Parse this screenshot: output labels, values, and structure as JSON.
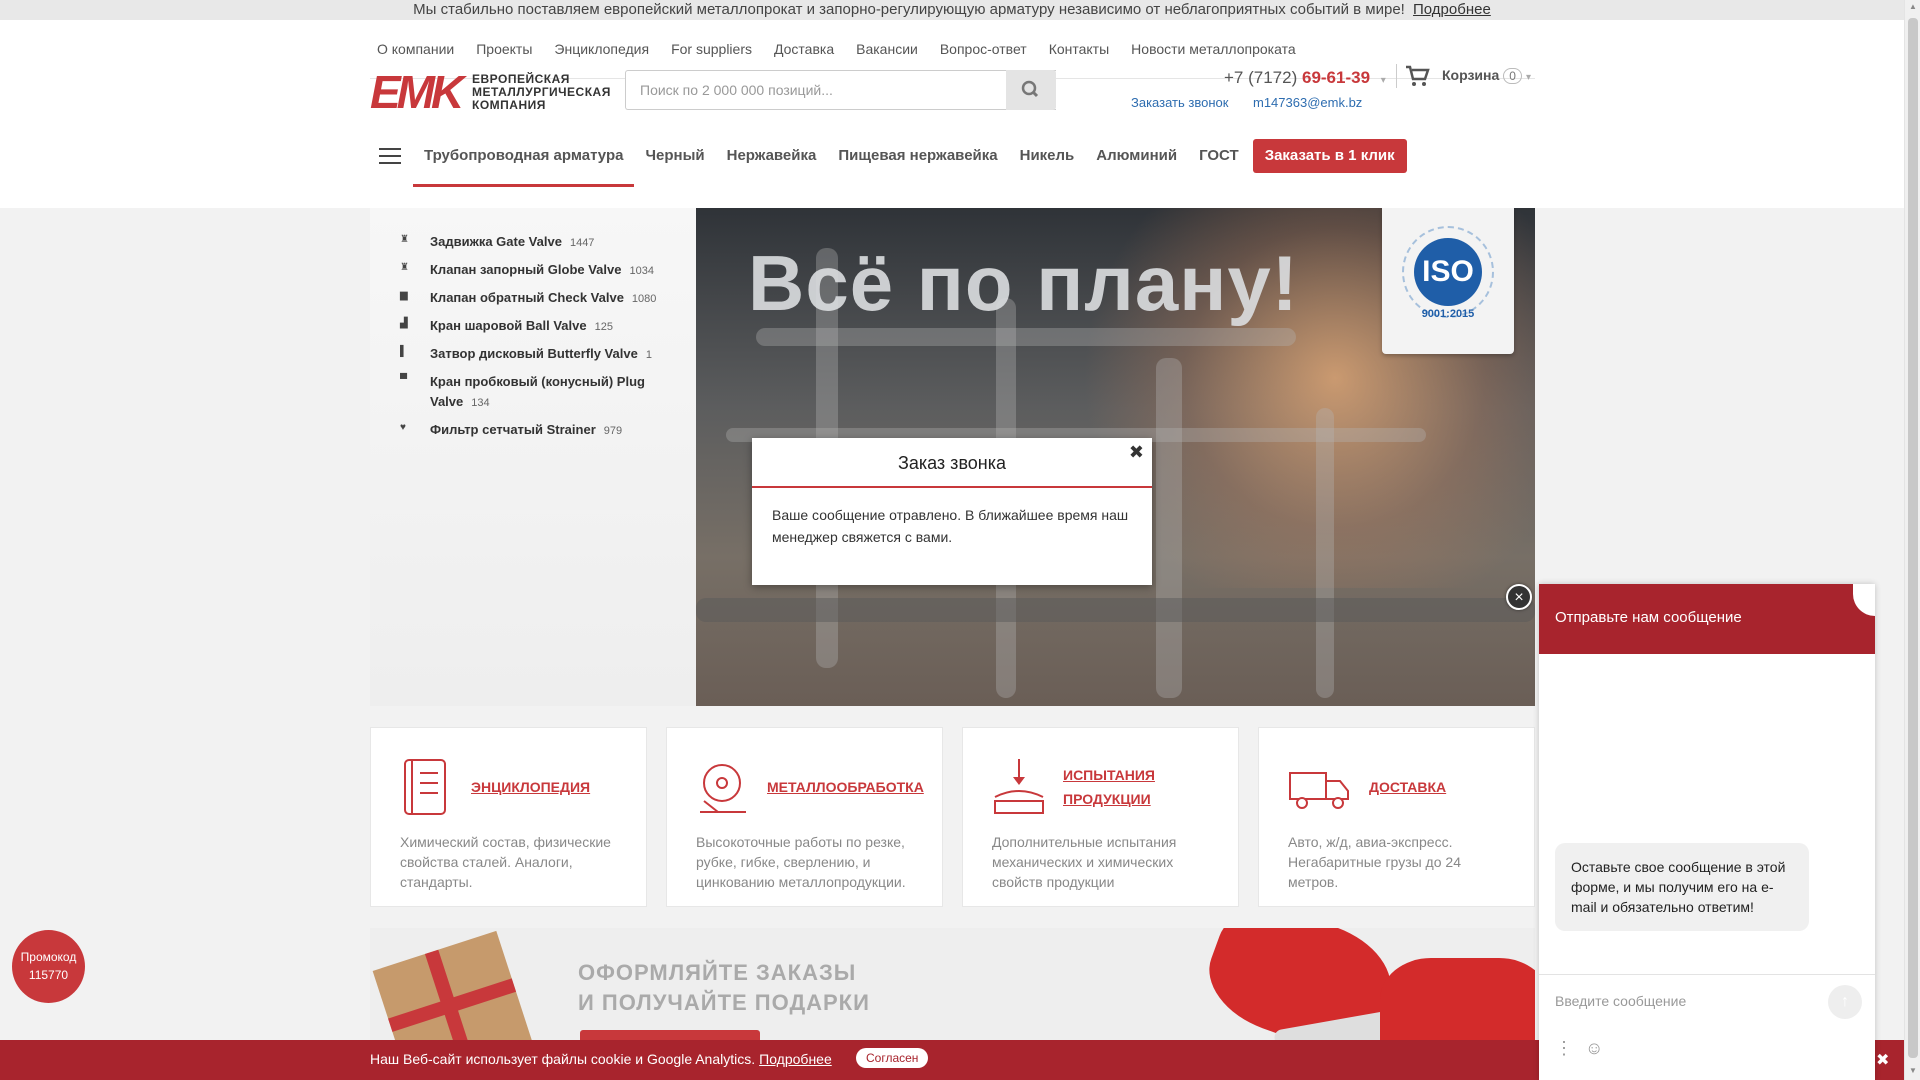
{
  "announcement": {
    "text": "Мы стабильно поставляем европейский металлопрокат и запорно-регулирующую арматуру независимо от неблагоприятных событий в мире!",
    "link": "Подробнее"
  },
  "top_nav": [
    "О компании",
    "Проекты",
    "Энциклопедия",
    "For suppliers",
    "Доставка",
    "Вакансии",
    "Вопрос-ответ",
    "Контакты",
    "Новости металлопроката"
  ],
  "logo": {
    "mark": "EMK",
    "line1": "ЕВРОПЕЙСКАЯ",
    "line2": "МЕТАЛЛУРГИЧЕСКАЯ",
    "line3": "КОМПАНИЯ"
  },
  "search": {
    "placeholder": "Поиск по 2 000 000 позиций..."
  },
  "contact": {
    "phone_prefix": "+7 (7172)",
    "phone_number": "69-61-39",
    "callback": "Заказать звонок",
    "email": "m147363@emk.bz"
  },
  "cart": {
    "label": "Корзина",
    "count": "0"
  },
  "category_nav": {
    "items": [
      "Трубопроводная арматура",
      "Черный",
      "Нержавейка",
      "Пищевая нержавейка",
      "Никель",
      "Алюминий",
      "ГОСТ"
    ],
    "order_button": "Заказать в 1 клик"
  },
  "hero": {
    "title": "Всё по плану!",
    "iso_text": "ISO",
    "iso_year": "9001:2015"
  },
  "catalog": [
    {
      "name": "Задвижка Gate Valve",
      "count": "1447"
    },
    {
      "name": "Клапан запорный Globe Valve",
      "count": "1034"
    },
    {
      "name": "Клапан обратный Check Valve",
      "count": "1080"
    },
    {
      "name": "Кран шаровой Ball Valve",
      "count": "125"
    },
    {
      "name": "Затвор дисковый Butterfly Valve",
      "count": "1"
    },
    {
      "name": "Кран пробковый (конусный) Plug Valve",
      "count": "134"
    },
    {
      "name": "Фильтр сетчатый Strainer",
      "count": "979"
    }
  ],
  "modal": {
    "title": "Заказ звонка",
    "close": "✖",
    "message": "Ваше сообщение отравлено. В ближайшее время наш менеджер свяжется с вами."
  },
  "cards": [
    {
      "title": "ЭНЦИКЛОПЕДИЯ",
      "desc": "Химический состав, физические свойства сталей. Аналоги, стандарты.",
      "icon": "book-icon"
    },
    {
      "title": "МЕТАЛЛООБРАБОТКА",
      "desc": "Высокоточные работы по резке, рубке, гибке, сверлению, и цинкованию металлопродукции.",
      "icon": "saw-icon"
    },
    {
      "title": "ИСПЫТАНИЯ ПРОДУКЦИИ",
      "desc": "Дополнительные испытания механических и химических свойств продукции",
      "icon": "press-icon"
    },
    {
      "title": "ДОСТАВКА",
      "desc": "Авто, ж/д, авиа-экспресс. Негабаритные грузы до 24 метров.",
      "icon": "truck-icon"
    }
  ],
  "banner": {
    "line1": "ОФОРМЛЯЙТЕ ЗАКАЗЫ",
    "line2": "И ПОЛУЧАЙТЕ ПОДАРКИ"
  },
  "promo": {
    "label": "Промокод",
    "code": "115770"
  },
  "cookie": {
    "text": "Наш Веб-сайт использует файлы cookie и Google Analytics.",
    "link": "Подробнее",
    "agree": "Согласен",
    "close": "✖"
  },
  "chat": {
    "header": "Отправьте нам сообщение",
    "bubble": "Оставьте свое сообщение в этой форме, и мы получим его на e-mail и обязательно ответим!",
    "placeholder": "Введите сообщение",
    "close": "×"
  },
  "colors": {
    "brand_red": "#c8383b",
    "link_blue": "#2e6db0",
    "cookie_bg": "#a8242d"
  }
}
